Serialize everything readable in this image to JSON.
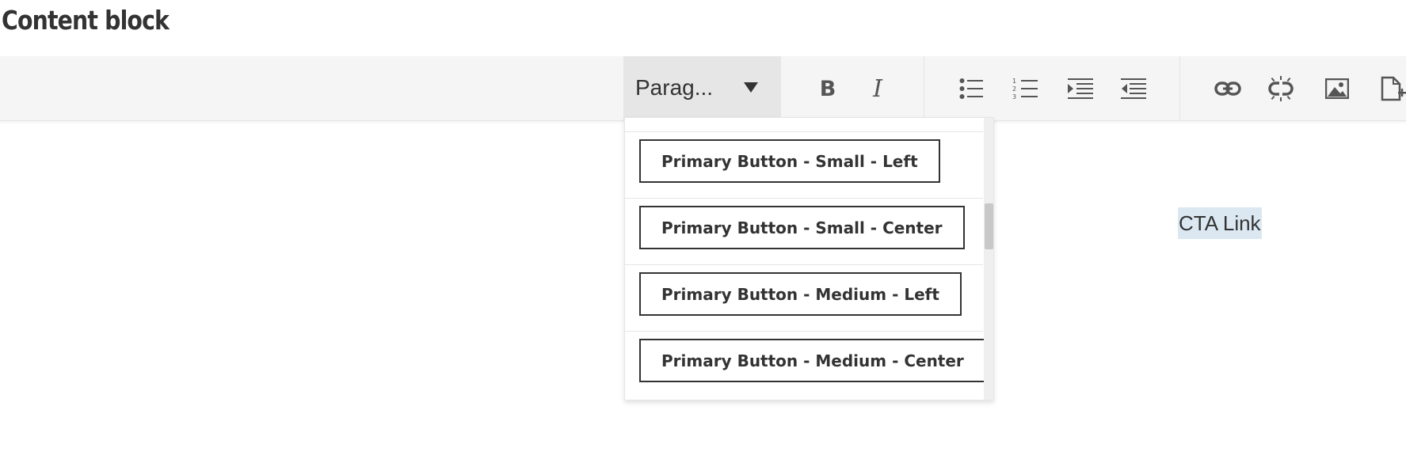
{
  "page": {
    "title": "Content block"
  },
  "toolbar": {
    "format_select": {
      "value": "Parag...",
      "caret_icon": "caret-down-icon"
    },
    "bold_label": "B",
    "italic_label": "I",
    "icons": {
      "bold": "bold-icon",
      "italic": "italic-icon",
      "bullet_list": "bulleted-list-icon",
      "numbered_list": "numbered-list-icon",
      "indent": "indent-icon",
      "outdent": "outdent-icon",
      "link": "link-icon",
      "unlink": "unlink-icon",
      "image": "image-icon",
      "insert_file": "insert-file-icon"
    }
  },
  "dropdown": {
    "items": [
      {
        "label": "Primary Button - Small - Left"
      },
      {
        "label": "Primary Button - Small - Center"
      },
      {
        "label": "Primary Button - Medium - Left"
      },
      {
        "label": "Primary Button - Medium - Center"
      }
    ]
  },
  "editor": {
    "selected_text": "CTA Link"
  },
  "colors": {
    "toolbar_bg": "#f5f5f5",
    "select_bg": "#e6e6e6",
    "text": "#333333",
    "icon": "#555555",
    "selection": "#dbe8f2"
  }
}
